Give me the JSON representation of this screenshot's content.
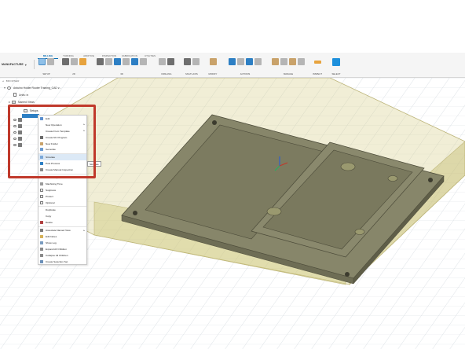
{
  "toolbar": {
    "workspace": "MANUFACTURE",
    "tabs": [
      "MILLING",
      "TURNING",
      "ADDITIVE",
      "INSPECTION",
      "FABRICATION",
      "UTILITIES"
    ],
    "active_tab": "MILLING",
    "groups": [
      {
        "label": "SETUP"
      },
      {
        "label": "2D"
      },
      {
        "label": "3D"
      },
      {
        "label": "DRILLING"
      },
      {
        "label": "MULTI-AXIS"
      },
      {
        "label": "MODIFY"
      },
      {
        "label": "ACTIONS"
      },
      {
        "label": "MANAGE"
      },
      {
        "label": "INSPECT"
      },
      {
        "label": "SELECT"
      }
    ]
  },
  "browser": {
    "header": "BROWSER",
    "rows": [
      {
        "label": "Arduino Holder Router Training_CAD v..."
      },
      {
        "label": "Units: in"
      },
      {
        "label": "Named Views"
      }
    ],
    "setups_label": "Setups"
  },
  "context_menu": {
    "items": [
      {
        "label": "Edit",
        "icon": "edit-icon"
      },
      {
        "label": "New Operation",
        "icon": "",
        "submenu": true
      },
      {
        "label": "Create From Template",
        "icon": "",
        "submenu": true
      },
      {
        "label": "Create NC Program",
        "icon": "nc-program-icon"
      },
      {
        "label": "New Folder",
        "icon": "folder-icon"
      },
      {
        "label": "Generate",
        "icon": "generate-icon"
      },
      {
        "label": "Simulate",
        "icon": "simulate-icon",
        "highlighted": true
      },
      {
        "label": "Post Process",
        "icon": "post-process-icon"
      },
      {
        "label": "Create Manual Inspection",
        "icon": "inspection-icon"
      },
      {
        "label": "Clear Toolpath",
        "icon": ""
      },
      {
        "label": "Machining Time",
        "icon": "clock-icon"
      },
      {
        "label": "Suppress",
        "icon": "checkbox-icon"
      },
      {
        "label": "Protect",
        "icon": "checkbox-icon"
      },
      {
        "label": "Optional",
        "icon": "checkbox-icon"
      },
      {
        "label": "Duplicate",
        "icon": ""
      },
      {
        "label": "Copy",
        "icon": ""
      },
      {
        "label": "Delete",
        "icon": "delete-icon"
      },
      {
        "label": "Associate Named View",
        "icon": "named-view-icon",
        "submenu": true
      },
      {
        "label": "Edit Notes",
        "icon": "notes-icon"
      },
      {
        "label": "Show Log",
        "icon": "log-icon"
      },
      {
        "label": "Expand All Children",
        "icon": "expand-icon"
      },
      {
        "label": "Collapse All Children",
        "icon": "collapse-icon"
      },
      {
        "label": "Create Selection Set",
        "icon": "selection-set-icon"
      }
    ],
    "tooltip": "Simulate"
  },
  "colors": {
    "accent": "#0a6fb5",
    "highlight_border": "#c0392b",
    "stock": "#d8cf8a",
    "part": "#7e7d5c"
  }
}
